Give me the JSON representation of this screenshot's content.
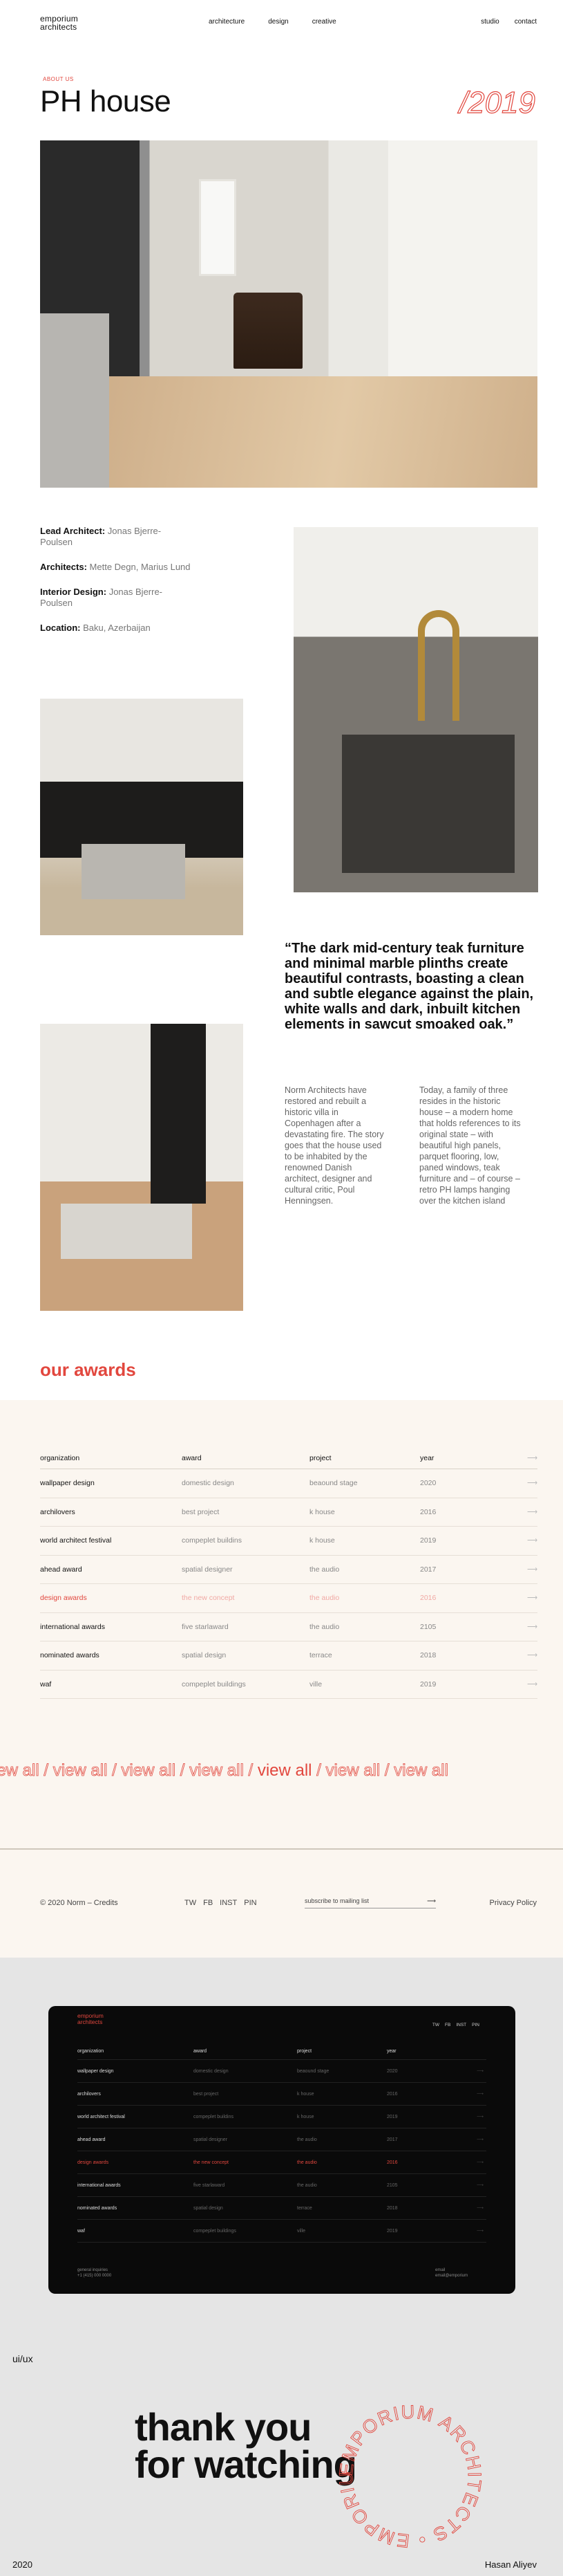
{
  "header": {
    "logo_line1": "emporium",
    "logo_line2": "architects",
    "nav": [
      "architecture",
      "design",
      "creative"
    ],
    "side_nav": [
      "studio",
      "contact"
    ]
  },
  "hero": {
    "eyebrow": "ABOUT US",
    "title": "PH house",
    "year": "/2019"
  },
  "credits": [
    {
      "label": "Lead Architect:",
      "value": "Jonas Bjerre-Poulsen"
    },
    {
      "label": "Architects:",
      "value": "Mette Degn, Marius Lund"
    },
    {
      "label": "Interior Design:",
      "value": "Jonas Bjerre-Poulsen"
    },
    {
      "label": "Location:",
      "value": "Baku, Azerbaijan"
    }
  ],
  "quote": "“The dark mid-century teak furniture and minimal marble plinths create beautiful contrasts, boasting a clean and subtle elegance against the plain, white walls and dark, inbuilt kitchen elements in sawcut smoaked oak.”",
  "body_col1": "Norm Architects have restored and rebuilt a historic villa in Copenhagen after a devastating fire. The story goes that the house used to be inhabited by the renowned Danish architect, designer and cultural critic, Poul Henningsen.",
  "body_col2": "Today, a family of three resides in the historic house – a modern home that holds references to its original state – with beautiful high panels, parquet flooring, low, paned windows, teak furniture and – of course – retro PH lamps hanging over the kitchen island",
  "awards": {
    "title": "our awards",
    "headers": [
      "organization",
      "award",
      "project",
      "year"
    ],
    "rows": [
      [
        "wallpaper design",
        "domestic design",
        "beaound stage",
        "2020"
      ],
      [
        "archilovers",
        "best project",
        "k house",
        "2016"
      ],
      [
        "world architect festival",
        "compeplet buildins",
        "k house",
        "2019"
      ],
      [
        "ahead award",
        "spatial designer",
        "the audio",
        "2017"
      ],
      [
        "design awards",
        "the new concept",
        "the audio",
        "2016"
      ],
      [
        "international awards",
        "five starlaward",
        "the audio",
        "2105"
      ],
      [
        "nominated awards",
        "spatial design",
        "terrace",
        "2018"
      ],
      [
        "waf",
        "compeplet buildings",
        "ville",
        "2019"
      ]
    ],
    "highlight_row": 4,
    "row_arrow": "⟶",
    "view_all": [
      "iew all /",
      "view all /",
      "view all /",
      "view all /",
      "view all",
      "/ view all /",
      "view all"
    ]
  },
  "footer": {
    "copyright": "© 2020 Norm – Credits",
    "social": [
      "TW",
      "FB",
      "INST",
      "PIN"
    ],
    "subscribe": "subscribe to mailing list",
    "policy": "Privacy Policy"
  },
  "mockup": {
    "logo_line1": "emporium",
    "logo_line2": "architects",
    "social": [
      "TW",
      "FB",
      "INST",
      "PIN"
    ],
    "headers": [
      "organization",
      "award",
      "project",
      "year"
    ],
    "rows": [
      [
        "wallpaper design",
        "domestic design",
        "beaound stage",
        "2020"
      ],
      [
        "archilovers",
        "best project",
        "k house",
        "2016"
      ],
      [
        "world architect festival",
        "compeplet buildins",
        "k house",
        "2019"
      ],
      [
        "ahead award",
        "spatial designer",
        "the audio",
        "2017"
      ],
      [
        "design awards",
        "the new concept",
        "the audio",
        "2016"
      ],
      [
        "international awards",
        "five starlaward",
        "the audio",
        "2105"
      ],
      [
        "nominated awards",
        "spatial design",
        "terrace",
        "2018"
      ],
      [
        "waf",
        "compeplet buildings",
        "ville",
        "2019"
      ]
    ],
    "highlight_row": 4,
    "general_label": "general inquiries",
    "general_phone": "+1 (415) 000 0000",
    "email_label": "email",
    "email_value": "email@emporium"
  },
  "outro": {
    "tag": "ui/ux",
    "thanks_line1": "thank you",
    "thanks_line2": "for watching",
    "stamp_text": "EMPORIUM ARCHITECTS • EMPORIUM ARCHITECTS •",
    "year": "2020",
    "author": "Hasan Aliyev"
  },
  "colors": {
    "accent": "#e2473e",
    "cream": "#fbf6f0",
    "dark": "#0a0a0a"
  }
}
